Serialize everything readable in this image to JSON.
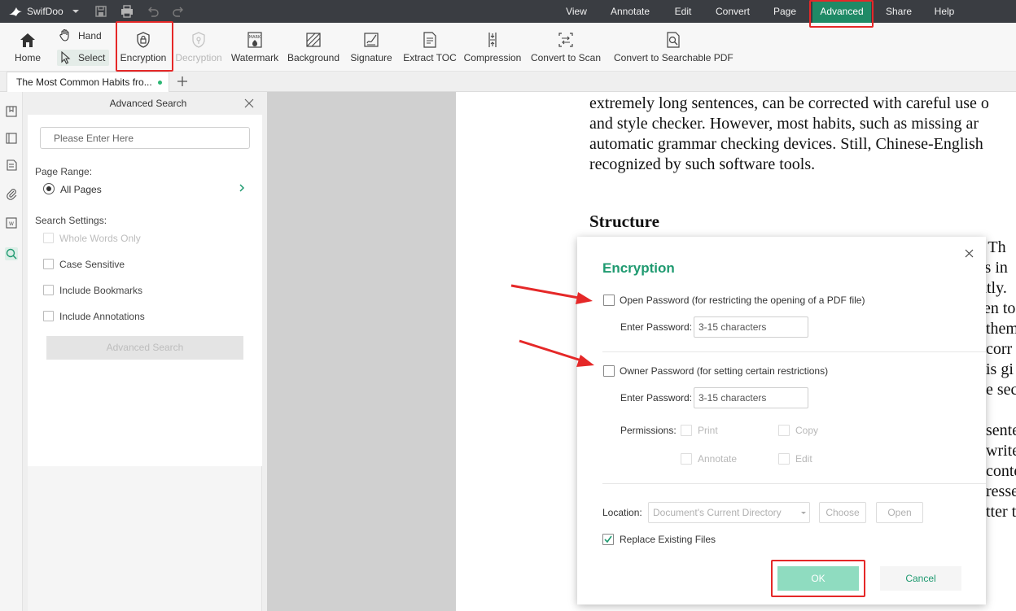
{
  "titlebar": {
    "app_name": "SwifDoo",
    "menus": [
      "View",
      "Annotate",
      "Edit",
      "Convert",
      "Page",
      "Advanced",
      "Share",
      "Help"
    ],
    "active_menu": "Advanced"
  },
  "toolbar": {
    "home": "Home",
    "hand": "Hand",
    "select": "Select",
    "encryption": "Encryption",
    "decryption": "Decryption",
    "watermark": "Watermark",
    "background": "Background",
    "signature": "Signature",
    "extract_toc": "Extract TOC",
    "compression": "Compression",
    "convert_to_scan": "Convert to Scan",
    "convert_to_searchable": "Convert to Searchable PDF"
  },
  "tab": {
    "title": "The Most Common Habits fro..."
  },
  "search_panel": {
    "title": "Advanced Search",
    "placeholder": "Please Enter Here",
    "page_range_label": "Page Range:",
    "page_range_value": "All Pages",
    "settings_label": "Search Settings:",
    "options": {
      "whole_words": "Whole Words Only",
      "case_sensitive": "Case Sensitive",
      "include_bookmarks": "Include Bookmarks",
      "include_annotations": "Include Annotations"
    },
    "button": "Advanced Search"
  },
  "document": {
    "lines": [
      "extremely long sentences, can be corrected with careful use o",
      "and style checker.  However, most habits, such as missing ar",
      "automatic grammar checking devices.  Still, Chinese-English",
      "recognized by such software tools."
    ],
    "heading": "Structure",
    "fragments": [
      "s.  Th",
      "ts in",
      "ntly.",
      "ven to",
      "them",
      "corr",
      "is gi",
      "e seco",
      "sente",
      "write",
      "conte",
      "resse",
      "tter t"
    ]
  },
  "dialog": {
    "title": "Encryption",
    "open_password_label": "Open Password (for restricting the opening of a PDF file)",
    "owner_password_label": "Owner Password (for setting certain restrictions)",
    "enter_password": "Enter Password:",
    "password_placeholder": "3-15 characters",
    "permissions_label": "Permissions:",
    "permissions": {
      "print": "Print",
      "copy": "Copy",
      "annotate": "Annotate",
      "edit": "Edit"
    },
    "location_label": "Location:",
    "location_value": "Document's Current Directory",
    "choose": "Choose",
    "open": "Open",
    "replace_existing": "Replace Existing Files",
    "ok": "OK",
    "cancel": "Cancel"
  },
  "colors": {
    "accent": "#1f9a70",
    "active_menu_bg": "#1f8a66",
    "highlight_border": "#e52828",
    "ok_button": "#8fdcc0"
  }
}
